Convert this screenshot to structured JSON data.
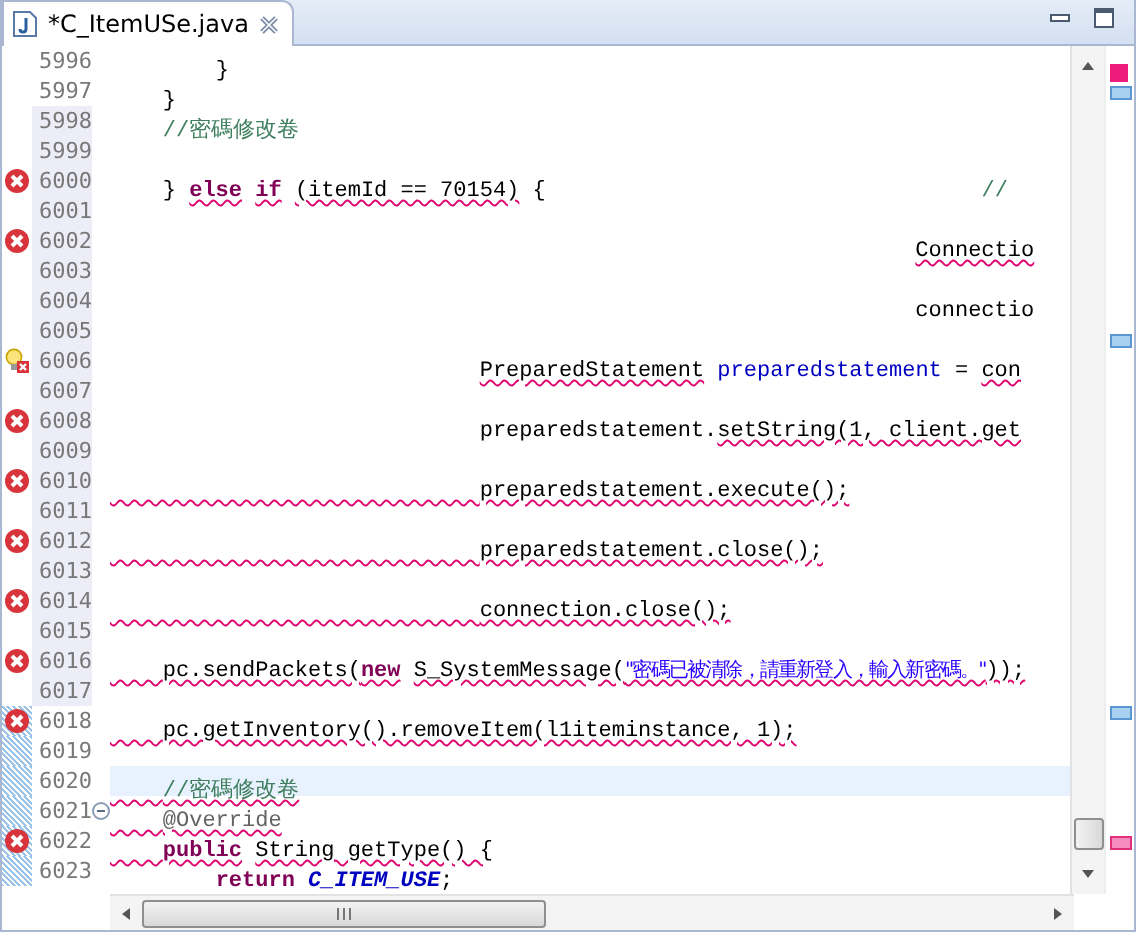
{
  "tab": {
    "title": "*C_ItemUSe.java",
    "selected": true
  },
  "lines": [
    {
      "number": "5996",
      "error": false,
      "quick_fix": false,
      "changed": false,
      "added": false,
      "current": false,
      "segments": [
        {
          "text": "        }",
          "kind": "plain",
          "error": false
        }
      ]
    },
    {
      "number": "5997",
      "error": false,
      "quick_fix": false,
      "changed": false,
      "added": false,
      "current": false,
      "segments": [
        {
          "text": "    }",
          "kind": "plain",
          "error": false
        }
      ]
    },
    {
      "number": "5998",
      "error": false,
      "quick_fix": false,
      "changed": true,
      "added": false,
      "current": false,
      "segments": [
        {
          "text": "    //密碼修改卷",
          "kind": "comment",
          "error": false
        }
      ]
    },
    {
      "number": "5999",
      "error": false,
      "quick_fix": false,
      "changed": true,
      "added": false,
      "current": false
    },
    {
      "number": "6000",
      "error": true,
      "quick_fix": false,
      "changed": true,
      "added": false,
      "current": false,
      "segments": [
        {
          "text": "    } ",
          "kind": "plain",
          "error": false
        },
        {
          "text": "else",
          "kind": "keyword",
          "error": true
        },
        {
          "text": " if",
          "kind": "keyword",
          "error": true
        },
        {
          "text": " (itemId == 70154)",
          "kind": "plain",
          "error": true
        },
        {
          "text": " {",
          "kind": "plain",
          "error": false
        },
        {
          "text": "                                 //",
          "kind": "comment",
          "error": false
        }
      ]
    },
    {
      "number": "6001",
      "error": false,
      "quick_fix": false,
      "changed": true,
      "added": false,
      "current": false
    },
    {
      "number": "6002",
      "error": true,
      "quick_fix": false,
      "changed": true,
      "added": false,
      "current": false,
      "segments": [
        {
          "text": "                                                             Connectio",
          "kind": "plain",
          "error": true
        }
      ]
    },
    {
      "number": "6003",
      "error": false,
      "quick_fix": false,
      "changed": true,
      "added": false,
      "current": false
    },
    {
      "number": "6004",
      "error": false,
      "quick_fix": false,
      "changed": true,
      "added": false,
      "current": false,
      "segments": [
        {
          "text": "                                                             connectio",
          "kind": "plain",
          "error": false
        }
      ]
    },
    {
      "number": "6005",
      "error": false,
      "quick_fix": false,
      "changed": true,
      "added": false,
      "current": false
    },
    {
      "number": "6006",
      "error": true,
      "quick_fix": true,
      "changed": true,
      "added": false,
      "current": false,
      "segments": [
        {
          "text": "                            PreparedStatement",
          "kind": "plain",
          "error": true
        },
        {
          "text": " preparedstatement",
          "kind": "variable",
          "error": false
        },
        {
          "text": " = ",
          "kind": "plain",
          "error": false
        },
        {
          "text": "con",
          "kind": "plain",
          "error": true
        }
      ]
    },
    {
      "number": "6007",
      "error": false,
      "quick_fix": false,
      "changed": true,
      "added": false,
      "current": false
    },
    {
      "number": "6008",
      "error": true,
      "quick_fix": false,
      "changed": true,
      "added": false,
      "current": false,
      "segments": [
        {
          "text": "                            preparedstatement.",
          "kind": "plain",
          "error": false
        },
        {
          "text": "setString(1, client.get",
          "kind": "plain",
          "error": true
        }
      ]
    },
    {
      "number": "6009",
      "error": false,
      "quick_fix": false,
      "changed": true,
      "added": false,
      "current": false
    },
    {
      "number": "6010",
      "error": true,
      "quick_fix": false,
      "changed": true,
      "added": false,
      "current": false,
      "segments": [
        {
          "text": "                            preparedstatement.execute();",
          "kind": "plain",
          "error": true,
          "indent_error": true
        }
      ]
    },
    {
      "number": "6011",
      "error": false,
      "quick_fix": false,
      "changed": true,
      "added": false,
      "current": false
    },
    {
      "number": "6012",
      "error": true,
      "quick_fix": false,
      "changed": true,
      "added": false,
      "current": false,
      "segments": [
        {
          "text": "                            preparedstatement.close();",
          "kind": "plain",
          "error": true,
          "indent_error": true
        }
      ]
    },
    {
      "number": "6013",
      "error": false,
      "quick_fix": false,
      "changed": true,
      "added": false,
      "current": false
    },
    {
      "number": "6014",
      "error": true,
      "quick_fix": false,
      "changed": true,
      "added": false,
      "current": false,
      "segments": [
        {
          "text": "                            connection.close();",
          "kind": "plain",
          "error": true,
          "indent_error": true
        }
      ]
    },
    {
      "number": "6015",
      "error": false,
      "quick_fix": false,
      "changed": true,
      "added": false,
      "current": false
    },
    {
      "number": "6016",
      "error": true,
      "quick_fix": false,
      "changed": true,
      "added": false,
      "current": false,
      "segments": [
        {
          "text": "    pc.sendPackets(",
          "kind": "plain",
          "error": true,
          "indent_error": true
        },
        {
          "text": "new",
          "kind": "keyword",
          "error": true
        },
        {
          "text": " S_SystemMessage(",
          "kind": "plain",
          "error": true
        },
        {
          "text": "\"密碼已被清除，請重新登入，輸入新密碼。\"",
          "kind": "string",
          "error": true
        },
        {
          "text": "));",
          "kind": "plain",
          "error": true
        }
      ]
    },
    {
      "number": "6017",
      "error": false,
      "quick_fix": false,
      "changed": true,
      "added": false,
      "current": false
    },
    {
      "number": "6018",
      "error": true,
      "quick_fix": false,
      "changed": false,
      "added": true,
      "current": false,
      "segments": [
        {
          "text": "    pc.getInventory().removeItem(l1iteminstance, 1);",
          "kind": "plain",
          "error": true,
          "indent_error": true
        }
      ]
    },
    {
      "number": "6019",
      "error": false,
      "quick_fix": false,
      "changed": false,
      "added": true,
      "current": false
    },
    {
      "number": "6020",
      "error": false,
      "quick_fix": false,
      "changed": false,
      "added": true,
      "current": true,
      "segments": [
        {
          "text": "    //密碼修改卷",
          "kind": "comment",
          "error": true,
          "indent_error": true
        }
      ]
    },
    {
      "number": "6021",
      "error": false,
      "quick_fix": false,
      "changed": false,
      "added": true,
      "current": false,
      "fold": {
        "expanded": true
      },
      "segments": [
        {
          "text": "    @Override",
          "kind": "annotation",
          "error": true,
          "indent_error": true
        }
      ]
    },
    {
      "number": "6022",
      "error": true,
      "quick_fix": false,
      "changed": false,
      "added": true,
      "current": false,
      "segments": [
        {
          "text": "    public",
          "kind": "keyword",
          "error": true,
          "indent_error": true
        },
        {
          "text": " String getType() {",
          "kind": "plain",
          "error": true
        }
      ]
    },
    {
      "number": "6023",
      "error": false,
      "quick_fix": false,
      "changed": false,
      "added": true,
      "current": false,
      "segments": [
        {
          "text": "        return",
          "kind": "keyword",
          "error": false
        },
        {
          "text": " C_ITEM_USE",
          "kind": "field",
          "error": false
        },
        {
          "text": ";",
          "kind": "plain",
          "error": false
        }
      ]
    }
  ]
}
